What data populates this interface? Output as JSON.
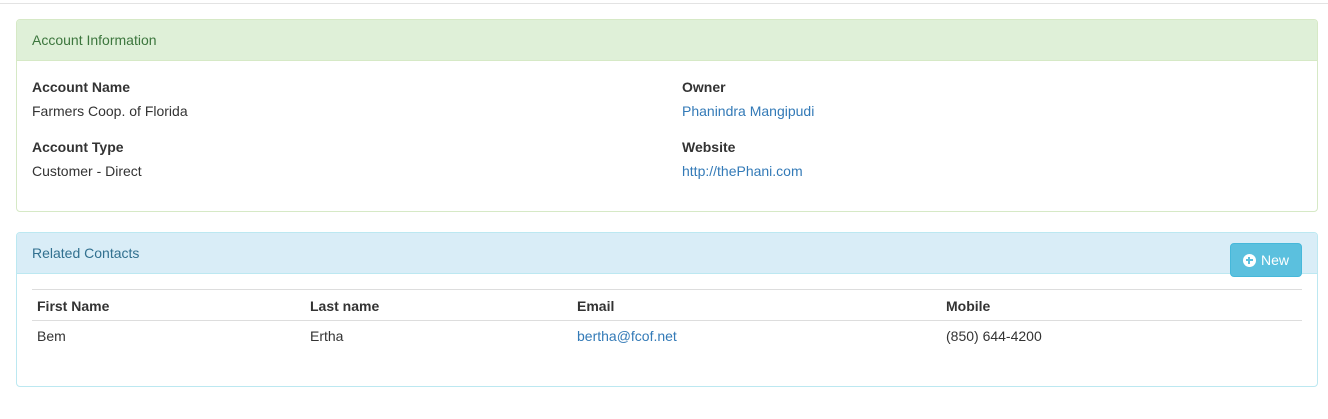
{
  "account_panel": {
    "title": "Account Information",
    "account_name_label": "Account Name",
    "account_name_value": "Farmers Coop. of Florida",
    "account_type_label": "Account Type",
    "account_type_value": "Customer - Direct",
    "owner_label": "Owner",
    "owner_value": "Phanindra Mangipudi",
    "website_label": "Website",
    "website_value": "http://thePhani.com"
  },
  "contacts_panel": {
    "title": "Related Contacts",
    "new_button_label": "New",
    "new_button_icon": "plus-circle-icon",
    "columns": [
      "First Name",
      "Last name",
      "Email",
      "Mobile"
    ],
    "rows": [
      {
        "first_name": "Bem",
        "last_name": "Ertha",
        "email": "bertha@fcof.net",
        "mobile": "(850) 644-4200"
      }
    ]
  },
  "colors": {
    "success_heading_bg": "#dff0d8",
    "success_heading_text": "#3c763d",
    "info_heading_bg": "#d9edf7",
    "info_heading_text": "#31708f",
    "link": "#337ab7",
    "info_button": "#5bc0de"
  }
}
